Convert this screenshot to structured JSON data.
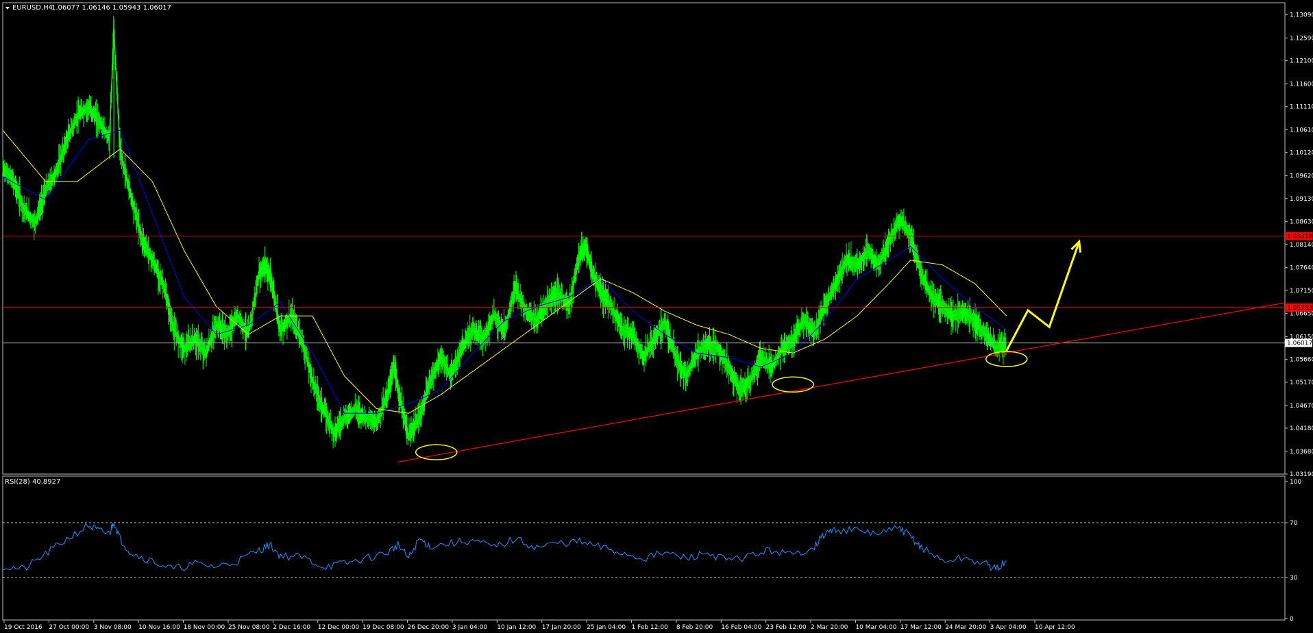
{
  "header": {
    "symbol": "EURUSD,H4",
    "ohlc": "1.06077 1.06146 1.05943 1.06017"
  },
  "rsi_header": "RSI(28) 40.8927",
  "colors": {
    "background": "#000000",
    "candles": "#00ff00",
    "ma_fast": "#0000ff",
    "ma_slow": "#ffff00",
    "level_lines": "#ff0000",
    "current_price_line": "#c0c0c0",
    "rsi_line": "#1e90ff",
    "annotations": "#ffff00"
  },
  "chart_data": [
    {
      "type": "line",
      "title": "EURUSD,H4",
      "price_labels": [
        "1.13090",
        "1.12590",
        "1.12100",
        "1.11600",
        "1.11110",
        "1.10610",
        "1.10120",
        "1.09620",
        "1.09130",
        "1.08630",
        "1.08140",
        "1.07640",
        "1.07150",
        "1.06650",
        "1.06150",
        "1.05660",
        "1.05170",
        "1.04670",
        "1.04180",
        "1.03680",
        "1.03190"
      ],
      "ylim": [
        1.0319,
        1.1335
      ],
      "x_labels": [
        "19 Oct 2016",
        "27 Oct 00:00",
        "3 Nov 08:00",
        "10 Nov 16:00",
        "18 Nov 00:00",
        "25 Nov 08:00",
        "2 Dec 16:00",
        "12 Dec 00:00",
        "19 Dec 08:00",
        "26 Dec 20:00",
        "3 Jan 04:00",
        "10 Jan 12:00",
        "17 Jan 20:00",
        "25 Jan 04:00",
        "1 Feb 12:00",
        "8 Feb 20:00",
        "16 Feb 04:00",
        "23 Feb 12:00",
        "2 Mar 20:00",
        "10 Mar 04:00",
        "17 Mar 12:00",
        "24 Mar 20:00",
        "3 Apr 04:00",
        "10 Apr 12:00"
      ],
      "price_path": [
        [
          0,
          1.098
        ],
        [
          0.5,
          1.095
        ],
        [
          1,
          1.089
        ],
        [
          1.5,
          1.086
        ],
        [
          2,
          1.093
        ],
        [
          2.5,
          1.097
        ],
        [
          3,
          1.104
        ],
        [
          3.5,
          1.109
        ],
        [
          4,
          1.111
        ],
        [
          4.5,
          1.108
        ],
        [
          5,
          1.104
        ],
        [
          5.2,
          1.128
        ],
        [
          5.5,
          1.101
        ],
        [
          6,
          1.092
        ],
        [
          6.5,
          1.083
        ],
        [
          7,
          1.078
        ],
        [
          7.5,
          1.073
        ],
        [
          8,
          1.063
        ],
        [
          8.5,
          1.059
        ],
        [
          9,
          1.061
        ],
        [
          9.5,
          1.058
        ],
        [
          10,
          1.064
        ],
        [
          10.5,
          1.062
        ],
        [
          11,
          1.066
        ],
        [
          11.5,
          1.062
        ],
        [
          12,
          1.075
        ],
        [
          12.3,
          1.077
        ],
        [
          12.6,
          1.073
        ],
        [
          13,
          1.063
        ],
        [
          13.5,
          1.066
        ],
        [
          14,
          1.061
        ],
        [
          14.5,
          1.052
        ],
        [
          15,
          1.046
        ],
        [
          15.5,
          1.041
        ],
        [
          16,
          1.044
        ],
        [
          16.5,
          1.046
        ],
        [
          17,
          1.044
        ],
        [
          17.5,
          1.043
        ],
        [
          18,
          1.049
        ],
        [
          18.3,
          1.055
        ],
        [
          18.6,
          1.048
        ],
        [
          19,
          1.04
        ],
        [
          19.5,
          1.044
        ],
        [
          20,
          1.052
        ],
        [
          20.5,
          1.057
        ],
        [
          21,
          1.053
        ],
        [
          21.5,
          1.059
        ],
        [
          22,
          1.063
        ],
        [
          22.5,
          1.061
        ],
        [
          23,
          1.066
        ],
        [
          23.5,
          1.063
        ],
        [
          24,
          1.072
        ],
        [
          24.5,
          1.067
        ],
        [
          25,
          1.065
        ],
        [
          25.5,
          1.069
        ],
        [
          26,
          1.071
        ],
        [
          26.5,
          1.068
        ],
        [
          27,
          1.079
        ],
        [
          27.3,
          1.081
        ],
        [
          27.6,
          1.075
        ],
        [
          28,
          1.071
        ],
        [
          28.5,
          1.068
        ],
        [
          29,
          1.063
        ],
        [
          29.5,
          1.062
        ],
        [
          30,
          1.057
        ],
        [
          30.5,
          1.061
        ],
        [
          31,
          1.065
        ],
        [
          31.5,
          1.057
        ],
        [
          32,
          1.053
        ],
        [
          32.5,
          1.058
        ],
        [
          33,
          1.06
        ],
        [
          33.5,
          1.059
        ],
        [
          34,
          1.055
        ],
        [
          34.5,
          1.05
        ],
        [
          35,
          1.052
        ],
        [
          35.5,
          1.057
        ],
        [
          36,
          1.055
        ],
        [
          36.5,
          1.059
        ],
        [
          37,
          1.061
        ],
        [
          37.5,
          1.065
        ],
        [
          38,
          1.062
        ],
        [
          38.5,
          1.068
        ],
        [
          39,
          1.073
        ],
        [
          39.5,
          1.078
        ],
        [
          40,
          1.077
        ],
        [
          40.5,
          1.08
        ],
        [
          41,
          1.077
        ],
        [
          41.5,
          1.082
        ],
        [
          42,
          1.087
        ],
        [
          42.5,
          1.083
        ],
        [
          43,
          1.075
        ],
        [
          43.5,
          1.07
        ],
        [
          44,
          1.068
        ],
        [
          44.5,
          1.066
        ],
        [
          45,
          1.067
        ],
        [
          45.5,
          1.065
        ],
        [
          46,
          1.062
        ],
        [
          46.5,
          1.059
        ],
        [
          47,
          1.06
        ]
      ],
      "ma_fast_path": [
        [
          0,
          1.096
        ],
        [
          2,
          1.091
        ],
        [
          4,
          1.104
        ],
        [
          5.5,
          1.106
        ],
        [
          7,
          1.088
        ],
        [
          8.5,
          1.07
        ],
        [
          10,
          1.062
        ],
        [
          11.5,
          1.064
        ],
        [
          13,
          1.069
        ],
        [
          14.5,
          1.058
        ],
        [
          16,
          1.045
        ],
        [
          17.5,
          1.045
        ],
        [
          19,
          1.047
        ],
        [
          20.5,
          1.05
        ],
        [
          22,
          1.058
        ],
        [
          23.5,
          1.065
        ],
        [
          25,
          1.068
        ],
        [
          26.5,
          1.07
        ],
        [
          28,
          1.074
        ],
        [
          29.5,
          1.067
        ],
        [
          31,
          1.062
        ],
        [
          32.5,
          1.058
        ],
        [
          34,
          1.057
        ],
        [
          35.5,
          1.055
        ],
        [
          37,
          1.058
        ],
        [
          38.5,
          1.065
        ],
        [
          40,
          1.074
        ],
        [
          41.5,
          1.078
        ],
        [
          42.5,
          1.081
        ],
        [
          44,
          1.074
        ],
        [
          45.5,
          1.068
        ],
        [
          47,
          1.063
        ]
      ],
      "ma_slow_path": [
        [
          0,
          1.106
        ],
        [
          2,
          1.095
        ],
        [
          3.5,
          1.095
        ],
        [
          5.5,
          1.102
        ],
        [
          7,
          1.095
        ],
        [
          8.5,
          1.08
        ],
        [
          10,
          1.068
        ],
        [
          11.5,
          1.062
        ],
        [
          13,
          1.066
        ],
        [
          14.5,
          1.066
        ],
        [
          16,
          1.053
        ],
        [
          17.5,
          1.046
        ],
        [
          19,
          1.045
        ],
        [
          20.5,
          1.049
        ],
        [
          22,
          1.054
        ],
        [
          23.5,
          1.059
        ],
        [
          25,
          1.064
        ],
        [
          26.5,
          1.069
        ],
        [
          28,
          1.074
        ],
        [
          29.5,
          1.071
        ],
        [
          31,
          1.067
        ],
        [
          32.5,
          1.064
        ],
        [
          34,
          1.062
        ],
        [
          35.5,
          1.059
        ],
        [
          37,
          1.058
        ],
        [
          38.5,
          1.061
        ],
        [
          40,
          1.066
        ],
        [
          41.5,
          1.073
        ],
        [
          42.5,
          1.078
        ],
        [
          44,
          1.077
        ],
        [
          45.5,
          1.073
        ],
        [
          47,
          1.066
        ]
      ],
      "resistance_levels": [
        {
          "value": 1.0832,
          "label": "1.08319"
        },
        {
          "value": 1.0678,
          "label": "1.06783"
        }
      ],
      "current_price": {
        "value": 1.06017,
        "label": "1.06017"
      },
      "trendline": {
        "from": [
          18.5,
          1.0345
        ],
        "to": [
          60,
          1.0688
        ]
      },
      "highlight_ellipses": [
        {
          "x": 20.3,
          "y": 1.0366
        },
        {
          "x": 37.0,
          "y": 1.0512
        },
        {
          "x": 47.0,
          "y": 1.0567
        }
      ],
      "forecast_arrow": [
        [
          47,
          1.0585
        ],
        [
          48,
          1.0672
        ],
        [
          49,
          1.0636
        ],
        [
          50.4,
          1.082
        ]
      ]
    },
    {
      "type": "line",
      "title": "RSI(28) 40.8927",
      "ylim": [
        0,
        100
      ],
      "y_labels": [
        "100",
        "70",
        "30",
        "0"
      ],
      "levels": [
        70,
        30
      ],
      "rsi_path": [
        [
          0,
          38
        ],
        [
          1,
          36
        ],
        [
          2,
          47
        ],
        [
          3,
          58
        ],
        [
          4,
          68
        ],
        [
          4.5,
          64
        ],
        [
          5,
          62
        ],
        [
          5.2,
          71
        ],
        [
          5.5,
          58
        ],
        [
          6,
          48
        ],
        [
          7,
          42
        ],
        [
          8,
          36
        ],
        [
          9,
          40
        ],
        [
          10,
          38
        ],
        [
          11,
          42
        ],
        [
          12,
          50
        ],
        [
          12.5,
          54
        ],
        [
          13,
          46
        ],
        [
          14,
          45
        ],
        [
          15,
          38
        ],
        [
          16,
          40
        ],
        [
          17,
          44
        ],
        [
          18,
          48
        ],
        [
          18.5,
          54
        ],
        [
          19,
          44
        ],
        [
          19.5,
          58
        ],
        [
          20,
          53
        ],
        [
          21,
          55
        ],
        [
          22,
          57
        ],
        [
          23,
          52
        ],
        [
          24,
          58
        ],
        [
          25,
          52
        ],
        [
          26,
          55
        ],
        [
          27,
          56
        ],
        [
          28,
          52
        ],
        [
          29,
          48
        ],
        [
          30,
          44
        ],
        [
          31,
          48
        ],
        [
          32,
          44
        ],
        [
          33,
          48
        ],
        [
          34,
          42
        ],
        [
          35,
          46
        ],
        [
          36,
          50
        ],
        [
          37,
          46
        ],
        [
          38,
          53
        ],
        [
          38.5,
          62
        ],
        [
          39,
          65
        ],
        [
          40,
          64
        ],
        [
          41,
          62
        ],
        [
          42,
          66
        ],
        [
          42.5,
          60
        ],
        [
          43,
          52
        ],
        [
          44,
          42
        ],
        [
          45,
          44
        ],
        [
          46,
          40
        ],
        [
          46.5,
          36
        ],
        [
          47,
          42
        ]
      ]
    }
  ]
}
